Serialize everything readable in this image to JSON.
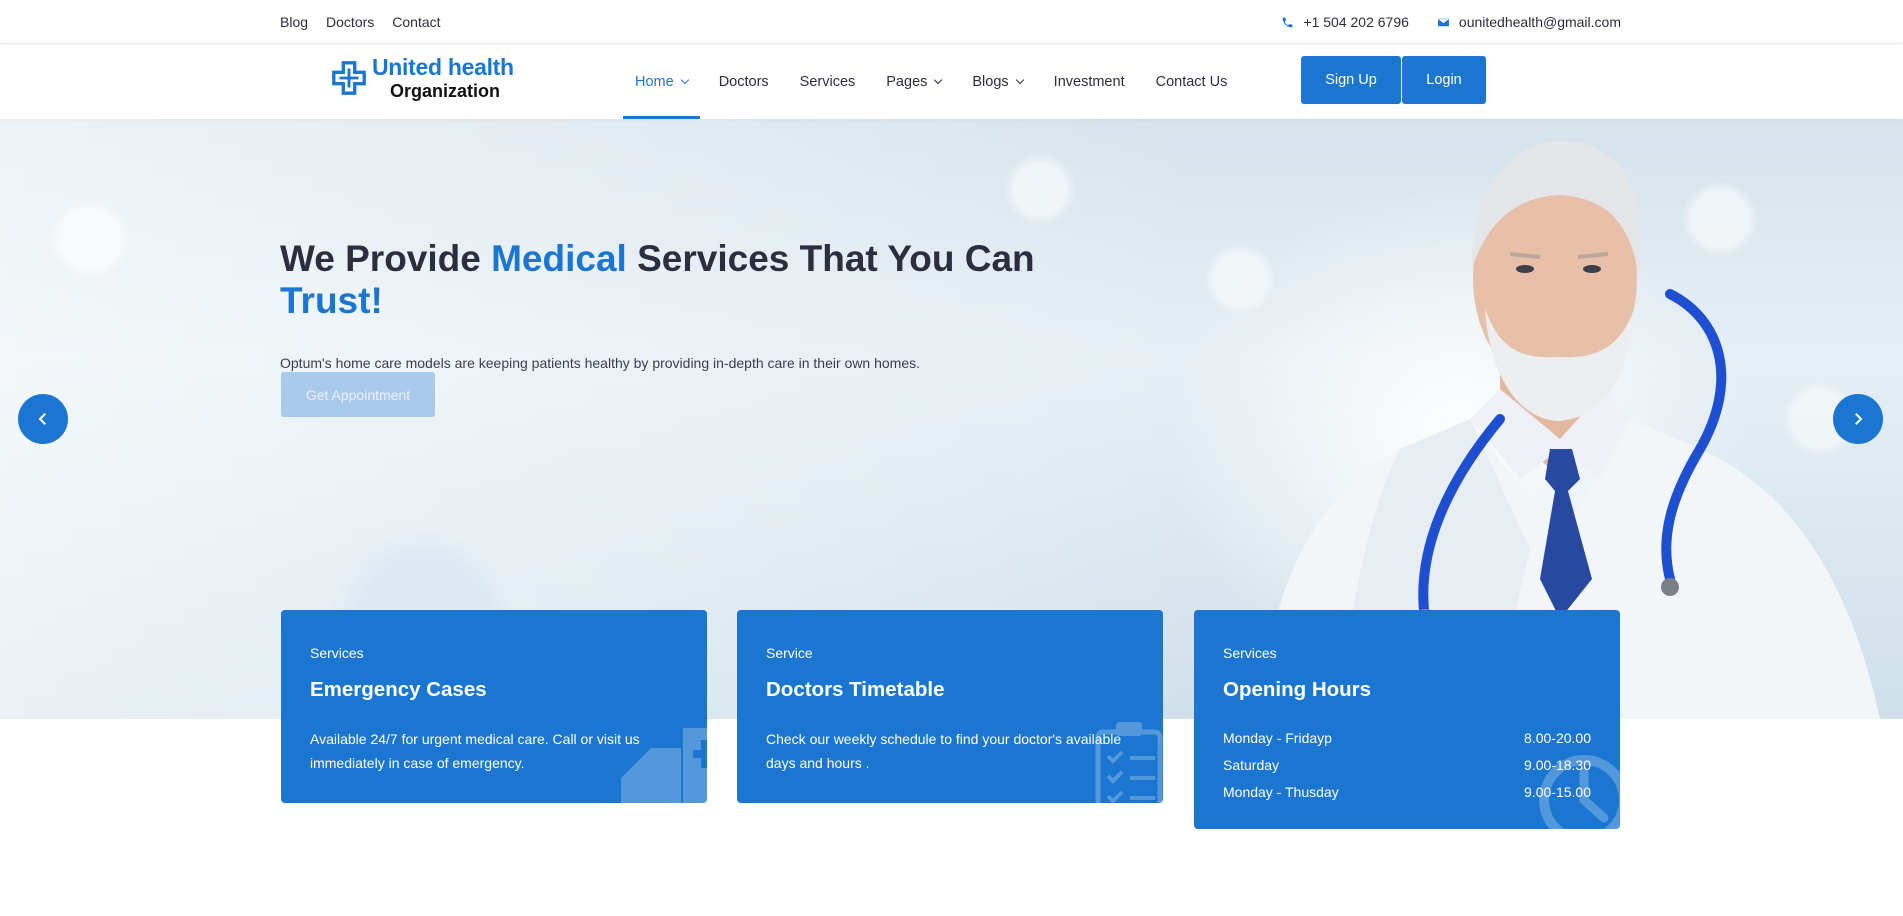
{
  "topbar": {
    "links": [
      "Blog",
      "Doctors",
      "Contact"
    ],
    "phone": "+1 504 202 6796",
    "email": "ounitedhealth@gmail.com"
  },
  "logo": {
    "line1": "United health",
    "line2": "Organization"
  },
  "nav": {
    "items": [
      {
        "label": "Home",
        "dropdown": true,
        "active": true
      },
      {
        "label": "Doctors",
        "dropdown": false
      },
      {
        "label": "Services",
        "dropdown": false
      },
      {
        "label": "Pages",
        "dropdown": true
      },
      {
        "label": "Blogs",
        "dropdown": true
      },
      {
        "label": "Investment",
        "dropdown": false
      },
      {
        "label": "Contact Us",
        "dropdown": false
      }
    ],
    "signup": "Sign Up",
    "login": "Login"
  },
  "hero": {
    "title_p1": "We Provide ",
    "title_hl1": "Medical",
    "title_p2": " Services That You Can ",
    "title_hl2": "Trust!",
    "subtitle": "Optum's home care models are keeping patients healthy by providing in-depth care in their own homes.",
    "cta": "Get Appointment"
  },
  "cards": {
    "emergency": {
      "label": "Services",
      "title": "Emergency Cases",
      "desc": "Available 24/7 for urgent medical care. Call or visit us immediately in case of emergency."
    },
    "timetable": {
      "label": "Service",
      "title": "Doctors Timetable",
      "desc": "Check our weekly schedule to find your doctor's available days and hours ."
    },
    "hours": {
      "label": "Services",
      "title": "Opening Hours",
      "rows": [
        {
          "day": "Monday - Fridayp",
          "time": "8.00-20.00"
        },
        {
          "day": "Saturday",
          "time": "9.00-18.30"
        },
        {
          "day": "Monday - Thusday",
          "time": "9.00-15.00"
        }
      ]
    }
  },
  "colors": {
    "primary": "#1a76d1",
    "text": "#2c2d3f"
  },
  "icons": [
    "phone-icon",
    "envelope-icon",
    "chevron-left-icon",
    "chevron-right-icon",
    "ambulance-icon",
    "clipboard-icon",
    "clock-icon"
  ]
}
